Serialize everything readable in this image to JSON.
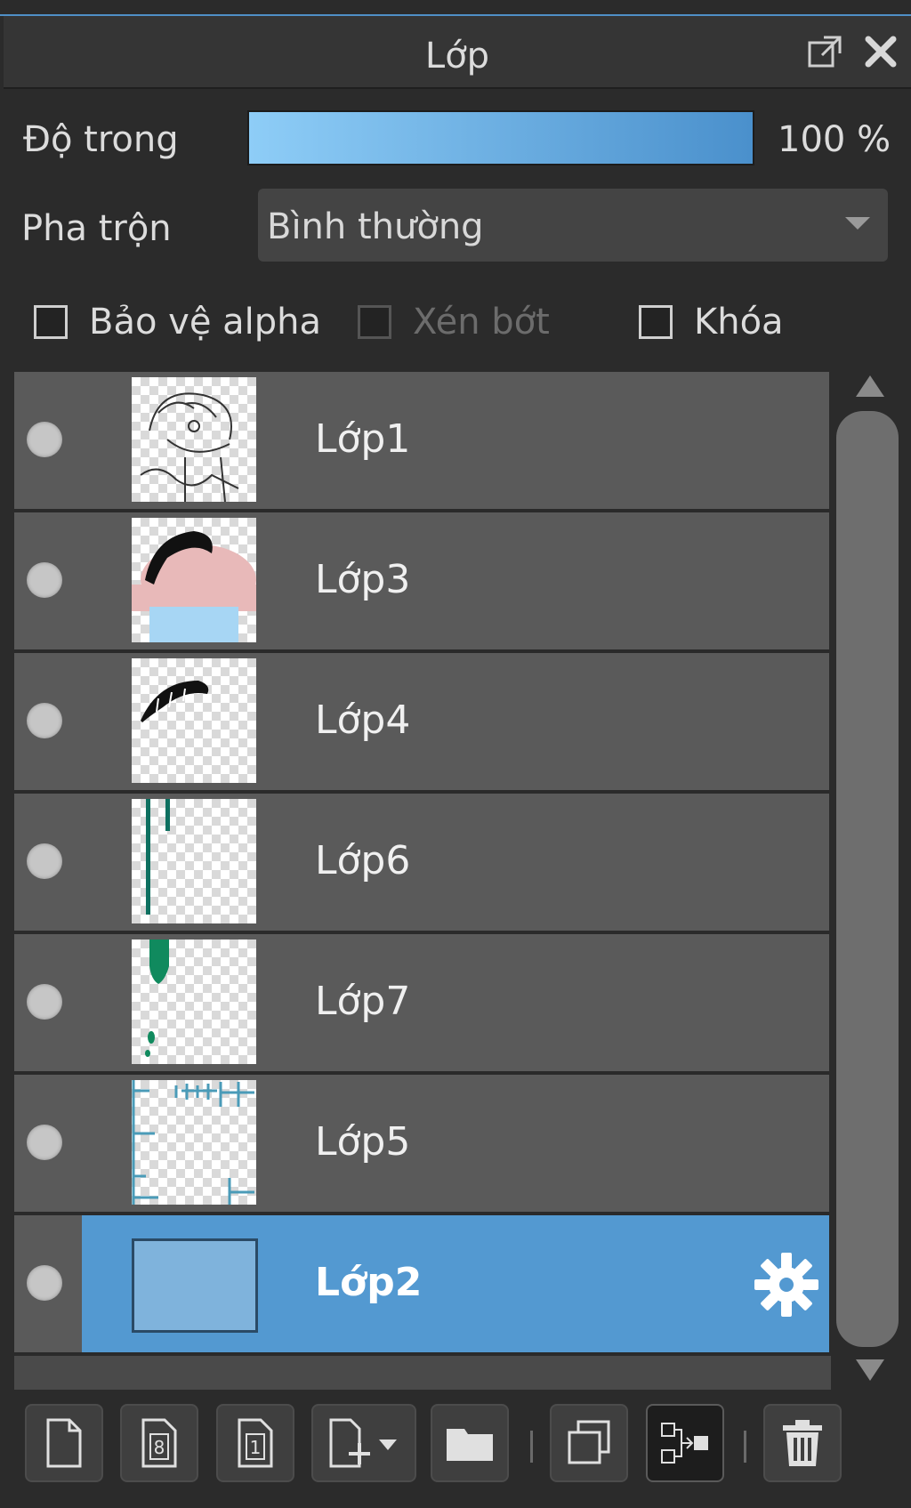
{
  "panel": {
    "title": "Lớp"
  },
  "opacity": {
    "label": "Độ trong",
    "value": "100 %",
    "fraction": 1.0
  },
  "blend": {
    "label": "Pha trộn",
    "value": "Bình thường"
  },
  "options": {
    "alpha_protect": "Bảo vệ alpha",
    "clip": "Xén bớt",
    "lock": "Khóa"
  },
  "layers": [
    {
      "name": "Lớp1",
      "icon": "lineart-thumb"
    },
    {
      "name": "Lớp3",
      "icon": "color-thumb"
    },
    {
      "name": "Lớp4",
      "icon": "hair-thumb"
    },
    {
      "name": "Lớp6",
      "icon": "lines-thumb"
    },
    {
      "name": "Lớp7",
      "icon": "green-thumb"
    },
    {
      "name": "Lớp5",
      "icon": "panel-thumb"
    },
    {
      "name": "Lớp2",
      "icon": "fill-thumb",
      "selected": true
    }
  ],
  "toolbar": {
    "buttons": [
      "new-layer-icon",
      "new-8bit-layer-icon",
      "new-1bit-layer-icon",
      "add-layer-menu-icon",
      "new-folder-icon",
      "duplicate-layer-icon",
      "merge-down-icon",
      "delete-layer-icon"
    ]
  },
  "colors": {
    "accent": "#5399d1",
    "panel_bg": "#2b2b2b",
    "layer_bg": "#5a5a5a"
  }
}
